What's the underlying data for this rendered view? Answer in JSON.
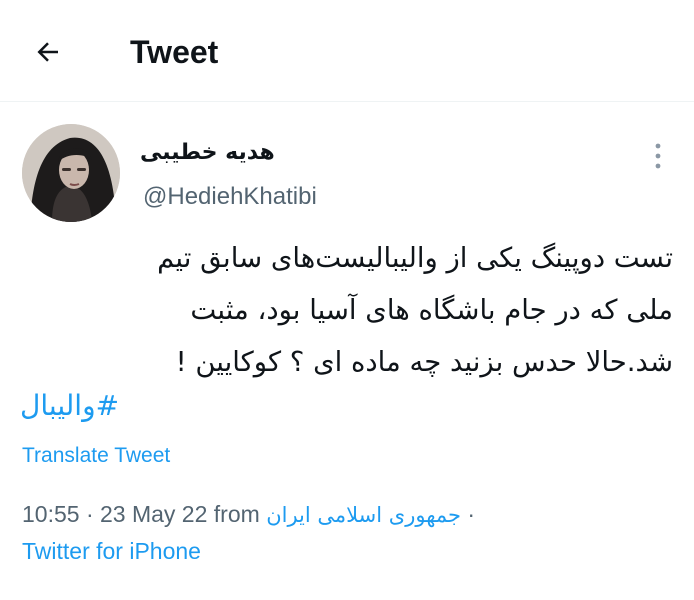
{
  "header": {
    "back_icon": "arrow-left-icon",
    "title": "Tweet"
  },
  "author": {
    "display_name": "هدیه خطیبی",
    "handle": "@HediehKhatibi",
    "avatar_icon": "profile-photo"
  },
  "more_icon": "vertical-ellipsis-icon",
  "tweet": {
    "lines": [
      "تست دوپینگ یکی از والیبالیست‌های سابق تیم",
      "ملی که در جام باشگاه های آسیا بود، مثبت",
      "شد.حالا حدس بزنید چه ماده ای ؟ کوکایین !"
    ],
    "hashtag": "#والیبال"
  },
  "translate_label": "Translate Tweet",
  "meta": {
    "time_date": "10:55 · 23 May 22 from",
    "location": "جمهوری اسلامی ایران",
    "separator": "·",
    "source": "Twitter for iPhone"
  },
  "colors": {
    "link": "#1d9bf0",
    "secondary_text": "#536471",
    "primary_text": "#0f1419",
    "divider": "#eff3f4"
  }
}
